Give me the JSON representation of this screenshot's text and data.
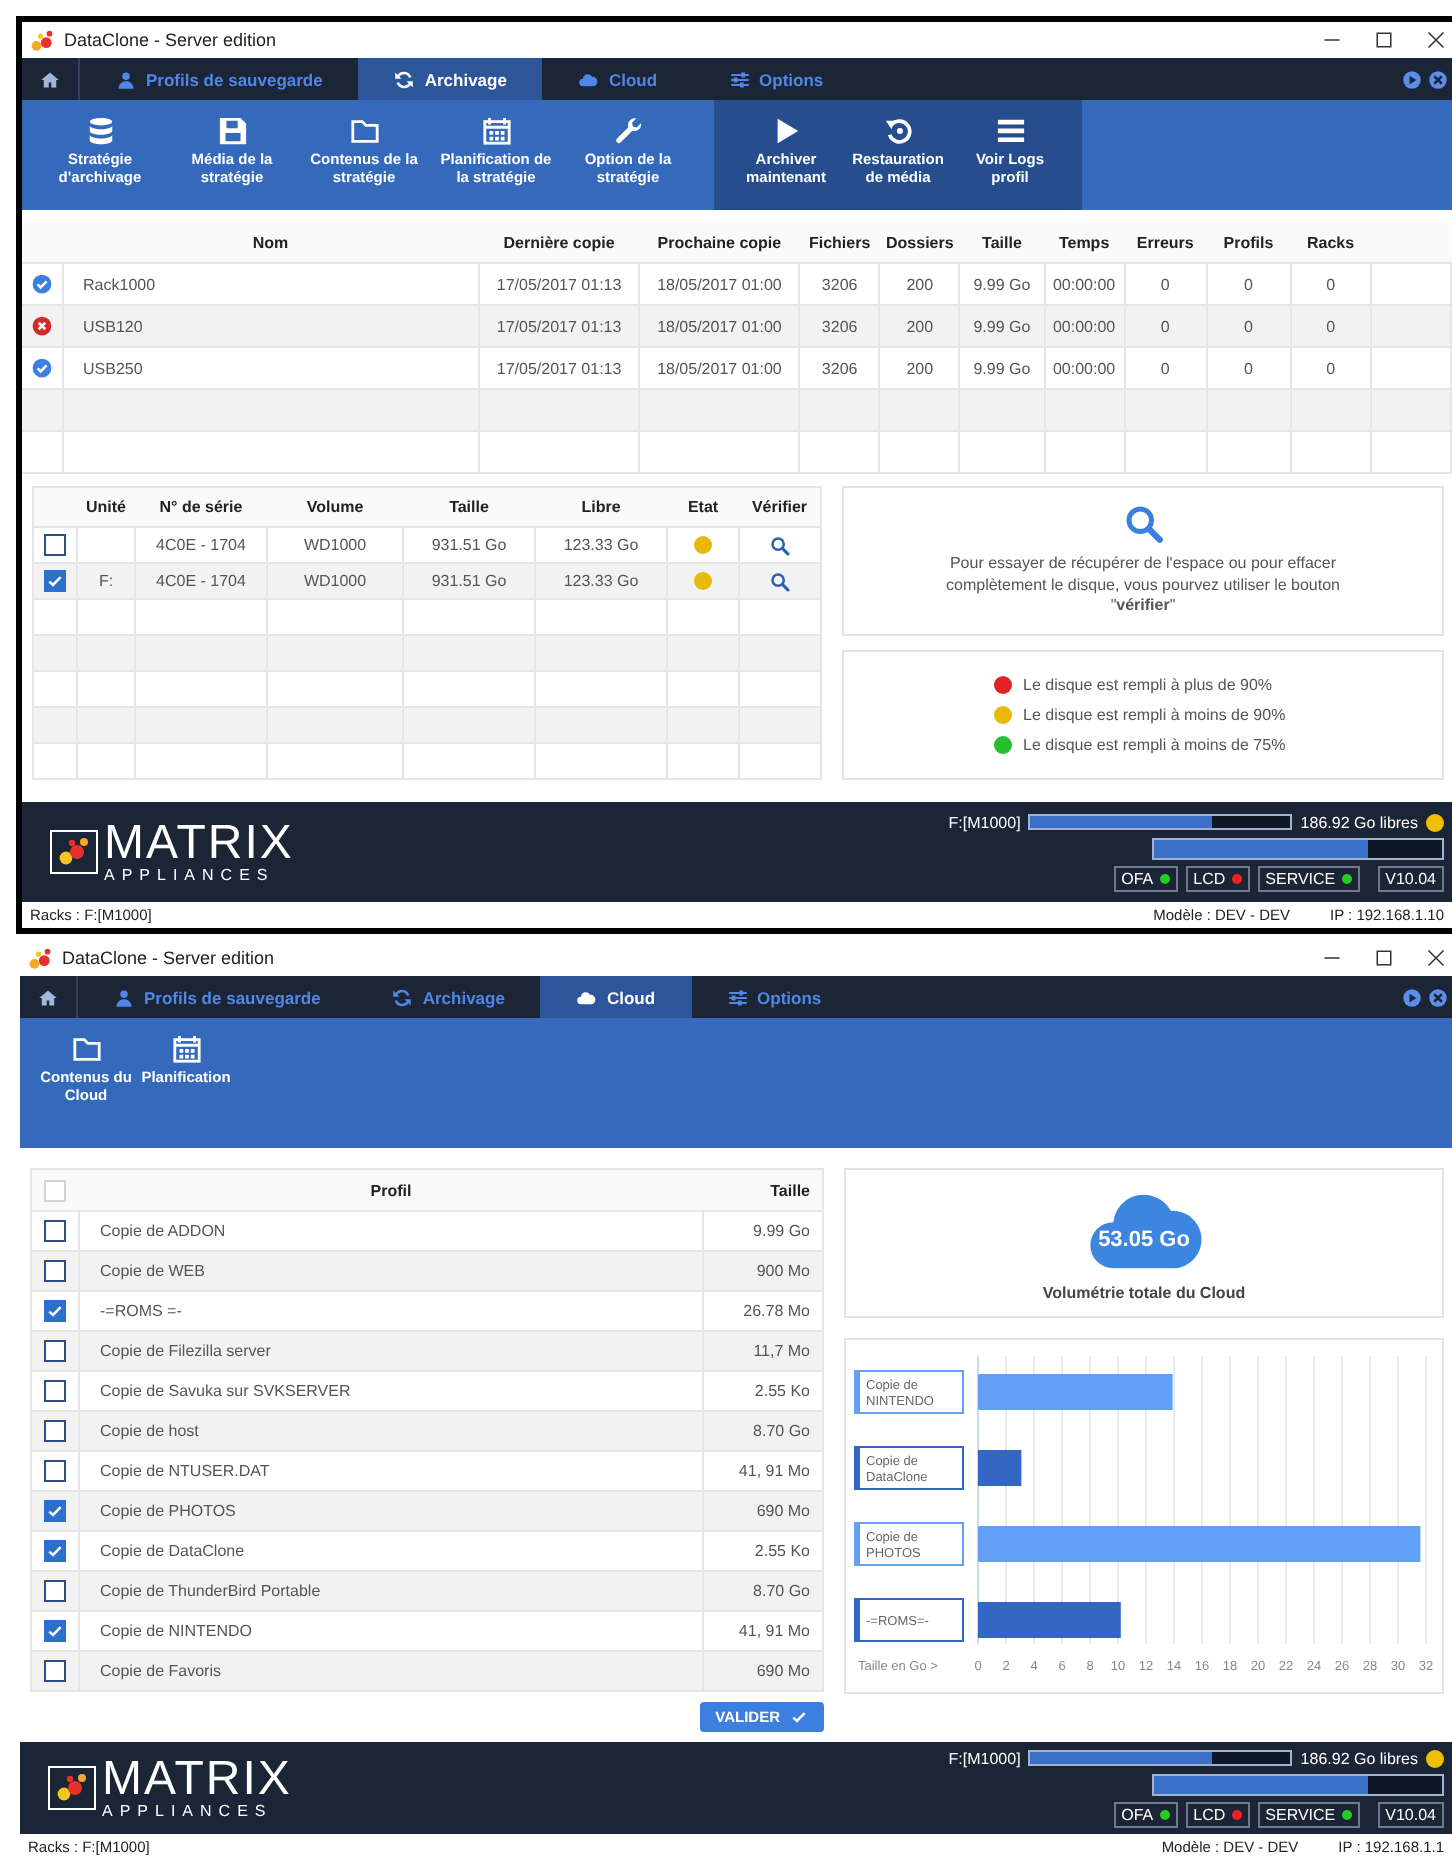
{
  "windows": [
    {
      "kind": "archivage",
      "title": "DataClone - Server edition",
      "tabs": [
        {
          "kind": "home",
          "selected": false
        },
        {
          "kind": "user",
          "label": "Profils de sauvegarde",
          "selected": false
        },
        {
          "kind": "sync",
          "label": "Archivage",
          "selected": true
        },
        {
          "kind": "cloud",
          "label": "Cloud",
          "selected": false
        },
        {
          "kind": "sliders",
          "label": "Options",
          "selected": false
        }
      ],
      "toolbar": {
        "strategy": [
          {
            "kind": "database",
            "label": "Stratégie d'archivage"
          },
          {
            "kind": "floppy",
            "label": "Média de la stratégie"
          },
          {
            "kind": "folder",
            "label": "Contenus de la stratégie"
          },
          {
            "kind": "calendar",
            "label": "Planification de la stratégie"
          },
          {
            "kind": "wrench",
            "label": "Option de la stratégie"
          }
        ],
        "actions": [
          {
            "kind": "play",
            "label": "Archiver maintenant"
          },
          {
            "kind": "restore",
            "label": "Restauration de média"
          },
          {
            "kind": "list",
            "label": "Voir Logs profil"
          }
        ]
      },
      "jobs": {
        "columns": [
          "Nom",
          "Dernière copie",
          "Prochaine copie",
          "Fichiers",
          "Dossiers",
          "Taille",
          "Temps",
          "Erreurs",
          "Profils",
          "Racks"
        ],
        "rows": [
          {
            "error": false,
            "cells": [
              "Rack1000",
              "17/05/2017 01:13",
              "18/05/2017 01:00",
              "3206",
              "200",
              "9.99 Go",
              "00:00:00",
              "0",
              "0",
              "0"
            ]
          },
          {
            "error": true,
            "cells": [
              "USB120",
              "17/05/2017 01:13",
              "18/05/2017 01:00",
              "3206",
              "200",
              "9.99 Go",
              "00:00:00",
              "0",
              "0",
              "0"
            ]
          },
          {
            "error": false,
            "cells": [
              "USB250",
              "17/05/2017 01:13",
              "18/05/2017 01:00",
              "3206",
              "200",
              "9.99 Go",
              "00:00:00",
              "0",
              "0",
              "0"
            ]
          }
        ]
      },
      "disks": {
        "columns": [
          "Unité",
          "N° de série",
          "Volume",
          "Taille",
          "Libre",
          "Etat",
          "Vérifier"
        ],
        "rows": [
          {
            "checked": false,
            "serial": "4C0E - 1704",
            "volume": "WD1000",
            "size": "931.51 Go",
            "free": "123.33 Go",
            "color": "#e8b80c"
          },
          {
            "checked": true,
            "unit": "F:",
            "serial": "4C0E - 1704",
            "volume": "WD1000",
            "size": "931.51 Go",
            "free": "123.33 Go",
            "color": "#e8b80c"
          }
        ]
      },
      "info": "Pour essayer de récupérer de l'espace ou pour effacer complètement le disque, vous pourvez utiliser le bouton \"**vérifier**\"",
      "legend": [
        {
          "color": "#e02424",
          "text": "Le disque est rempli à plus de 90%"
        },
        {
          "color": "#e8b80c",
          "text": "Le disque est rempli à moins de 90%"
        },
        {
          "color": "#22c02a",
          "text": "Le disque est rempli à moins de 75%"
        }
      ],
      "footer": {
        "logo": {
          "name": "MATRIX",
          "tagline": "APPLIANCES"
        },
        "drive": "F:[M1000]",
        "drive_bar": {
          "level": 0.7
        },
        "free": "186.92 Go libres",
        "free_dot": {
          "color": "#f0c000"
        },
        "total_bar": {
          "level": 0.74
        },
        "badges": [
          {
            "label": "OFA",
            "color": "#22cc22"
          },
          {
            "label": "LCD",
            "color": "#ee2222"
          },
          {
            "label": "SERVICE",
            "color": "#22cc22"
          }
        ],
        "version": "V10.04"
      },
      "status_bar": {
        "racks": "Racks : F:[M1000]",
        "model": "Modèle : DEV - DEV",
        "ip": "IP : 192.168.1.10"
      }
    },
    {
      "kind": "cloud",
      "title": "DataClone - Server edition",
      "tabs": [
        {
          "kind": "home",
          "selected": false
        },
        {
          "kind": "user",
          "label": "Profils de sauvegarde",
          "selected": false
        },
        {
          "kind": "sync",
          "label": "Archivage",
          "selected": false
        },
        {
          "kind": "cloud",
          "label": "Cloud",
          "selected": true
        },
        {
          "kind": "sliders",
          "label": "Options",
          "selected": false
        }
      ],
      "toolbar": {
        "cloud": [
          {
            "kind": "folder",
            "label": "Contenus du Cloud"
          },
          {
            "kind": "calendar",
            "label": "Planification"
          }
        ]
      },
      "profiles": {
        "select_all": {
          "checked": false,
          "disabled": true
        },
        "columns": [
          "Profil",
          "Taille"
        ],
        "rows": [
          {
            "checked": false,
            "name": "Copie de ADDON",
            "size": "9.99 Go"
          },
          {
            "checked": false,
            "name": "Copie de WEB",
            "size": "900 Mo"
          },
          {
            "checked": true,
            "name": "-=ROMS =-",
            "size": "26.78 Mo"
          },
          {
            "checked": false,
            "name": "Copie de Filezilla server",
            "size": "11,7 Mo"
          },
          {
            "checked": false,
            "name": "Copie de Savuka sur SVKSERVER",
            "size": "2.55 Ko"
          },
          {
            "checked": false,
            "name": "Copie de host",
            "size": "8.70 Go"
          },
          {
            "checked": false,
            "name": "Copie de NTUSER.DAT",
            "size": "41, 91 Mo"
          },
          {
            "checked": true,
            "name": "Copie de PHOTOS",
            "size": "690 Mo"
          },
          {
            "checked": true,
            "name": "Copie de DataClone",
            "size": "2.55 Ko"
          },
          {
            "checked": false,
            "name": "Copie de ThunderBird Portable",
            "size": "8.70 Go"
          },
          {
            "checked": true,
            "name": "Copie de NINTENDO",
            "size": "41, 91 Mo"
          },
          {
            "checked": false,
            "name": "Copie de Favoris",
            "size": "690 Mo"
          }
        ]
      },
      "total": {
        "value": "53.05 Go",
        "label": "Volumétrie totale du Cloud"
      },
      "chart_data": {
        "type": "bar",
        "orientation": "horizontal",
        "xlabel": "Taille en Go >",
        "categories": [
          "Copie de NINTENDO",
          "Copie de DataClone",
          "Copie de PHOTOS",
          "-=ROMS=-"
        ],
        "values": [
          13.9,
          3.1,
          31.6,
          10.2
        ],
        "colors": [
          "#62a0f8",
          "#3467c4",
          "#62a0f8",
          "#3467c4"
        ],
        "grid": true,
        "xlim": [
          0,
          32
        ],
        "xticks": [
          0,
          2,
          4,
          6,
          8,
          10,
          12,
          14,
          16,
          18,
          20,
          22,
          24,
          26,
          28,
          30,
          32
        ]
      },
      "validate_button": "VALIDER",
      "footer": {
        "logo": {
          "name": "MATRIX",
          "tagline": "APPLIANCES"
        },
        "drive": "F:[M1000]",
        "drive_bar": {
          "level": 0.7
        },
        "free": "186.92 Go libres",
        "free_dot": {
          "color": "#f0c000"
        },
        "total_bar": {
          "level": 0.74
        },
        "badges": [
          {
            "label": "OFA",
            "color": "#22cc22"
          },
          {
            "label": "LCD",
            "color": "#ee2222"
          },
          {
            "label": "SERVICE",
            "color": "#22cc22"
          }
        ],
        "version": "V10.04"
      },
      "status_bar": {
        "racks": "Racks : F:[M1000]",
        "model": "Modèle : DEV - DEV",
        "ip": "IP : 192.168.1.1"
      }
    }
  ]
}
